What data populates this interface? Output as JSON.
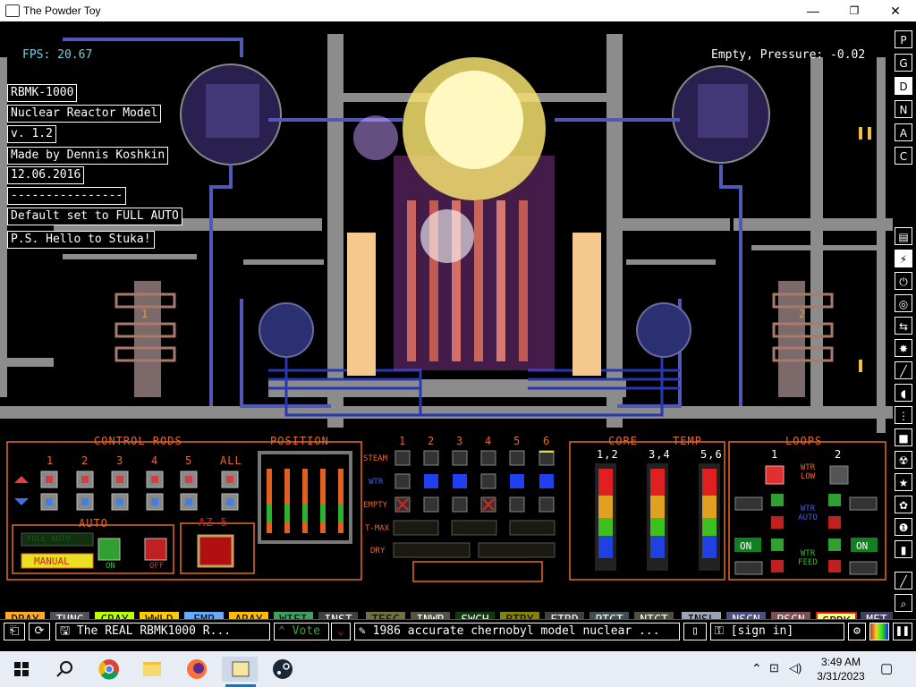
{
  "window": {
    "title": "The Powder Toy",
    "minimize": "—",
    "maximize": "❐",
    "close": "✕"
  },
  "hud": {
    "fps": "FPS: 20.67",
    "status": "Empty, Pressure: -0.02"
  },
  "signs": [
    "RBMK-1000",
    "Nuclear Reactor Model",
    "v. 1.2",
    "Made by Dennis Koshkin",
    "12.06.2016",
    "----------------",
    "Default set to FULL AUTO",
    "P.S. Hello to Stuka!"
  ],
  "panel": {
    "control_rods": "CONTROL RODS",
    "position": "POSITION",
    "rod_numbers": [
      "1",
      "2",
      "3",
      "4",
      "5",
      "ALL"
    ],
    "auto": "AUTO",
    "auto_mode": "FULL AUTO",
    "manual": "MANUAL",
    "on": "ON",
    "off": "OFF",
    "az5": "AZ-5",
    "channel_numbers": [
      "1",
      "2",
      "3",
      "4",
      "5",
      "6"
    ],
    "row_labels": [
      "STEAM",
      "WTR",
      "EMPTY",
      "T-MAX",
      "DRY"
    ],
    "core": "CORE",
    "temp": "TEMP",
    "temp_groups": [
      "1,2",
      "3,4",
      "5,6"
    ],
    "loops": "LOOPS",
    "loop_numbers": [
      "1",
      "2"
    ],
    "wtr_low": "WTR LOW",
    "wtr_auto": "WTR AUTO",
    "wtr_feed": "WTR FEED",
    "loop_on_1": "ON",
    "loop_on_2": "ON",
    "loop_label_1": "1",
    "loop_label_2": "2"
  },
  "right_toolbar": [
    "P",
    "G",
    "D",
    "N",
    "A",
    "C"
  ],
  "elements": [
    {
      "name": "DRAY",
      "color": "#ffaa22",
      "text": "#000"
    },
    {
      "name": "TUNG",
      "color": "#505058",
      "text": "#fff"
    },
    {
      "name": "CRAY",
      "color": "#bbff00",
      "text": "#000"
    },
    {
      "name": "WWLD",
      "color": "#ffcc00",
      "text": "#000"
    },
    {
      "name": "EMP",
      "color": "#66aaff",
      "text": "#000"
    },
    {
      "name": "ARAY",
      "color": "#ffbb00",
      "text": "#000"
    },
    {
      "name": "WIFI",
      "color": "#40a060",
      "text": "#000"
    },
    {
      "name": "INST",
      "color": "#404040",
      "text": "#fff"
    },
    {
      "name": "TESC",
      "color": "#707040",
      "text": "#000"
    },
    {
      "name": "INWR",
      "color": "#545444",
      "text": "#fff"
    },
    {
      "name": "SWCH",
      "color": "#103b11",
      "text": "#fff"
    },
    {
      "name": "BTRY",
      "color": "#858505",
      "text": "#000"
    },
    {
      "name": "ETRD",
      "color": "#404040",
      "text": "#fff"
    },
    {
      "name": "PTCT",
      "color": "#405050",
      "text": "#fff"
    },
    {
      "name": "NTCT",
      "color": "#505040",
      "text": "#fff"
    },
    {
      "name": "INSL",
      "color": "#9ea3b6",
      "text": "#000"
    },
    {
      "name": "NSCN",
      "color": "#505080",
      "text": "#fff"
    },
    {
      "name": "PSCN",
      "color": "#805050",
      "text": "#fff"
    },
    {
      "name": "SPRK",
      "color": "#ffff80",
      "text": "#000"
    },
    {
      "name": "MET",
      "color": "#404060",
      "text": "#fff"
    }
  ],
  "bottom_bar": {
    "save_title": "The REAL RBMK1000 R...",
    "vote": "Vote",
    "description": "1986 accurate chernobyl model nuclear ...",
    "sign_in": "[sign in]"
  },
  "taskbar": {
    "time": "3:49 AM",
    "date": "3/31/2023"
  }
}
